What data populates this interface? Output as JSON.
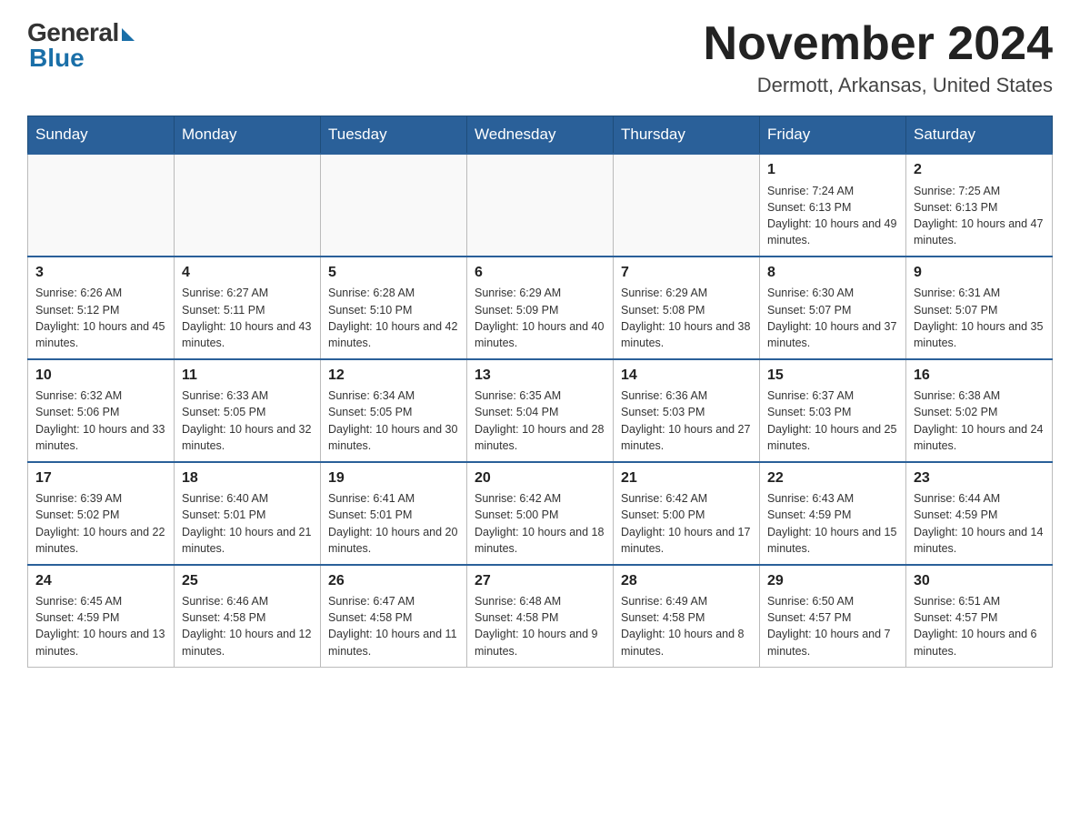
{
  "header": {
    "logo_general": "General",
    "logo_blue": "Blue",
    "month_title": "November 2024",
    "location": "Dermott, Arkansas, United States"
  },
  "weekdays": [
    "Sunday",
    "Monday",
    "Tuesday",
    "Wednesday",
    "Thursday",
    "Friday",
    "Saturday"
  ],
  "weeks": [
    [
      {
        "day": "",
        "info": ""
      },
      {
        "day": "",
        "info": ""
      },
      {
        "day": "",
        "info": ""
      },
      {
        "day": "",
        "info": ""
      },
      {
        "day": "",
        "info": ""
      },
      {
        "day": "1",
        "info": "Sunrise: 7:24 AM\nSunset: 6:13 PM\nDaylight: 10 hours and 49 minutes."
      },
      {
        "day": "2",
        "info": "Sunrise: 7:25 AM\nSunset: 6:13 PM\nDaylight: 10 hours and 47 minutes."
      }
    ],
    [
      {
        "day": "3",
        "info": "Sunrise: 6:26 AM\nSunset: 5:12 PM\nDaylight: 10 hours and 45 minutes."
      },
      {
        "day": "4",
        "info": "Sunrise: 6:27 AM\nSunset: 5:11 PM\nDaylight: 10 hours and 43 minutes."
      },
      {
        "day": "5",
        "info": "Sunrise: 6:28 AM\nSunset: 5:10 PM\nDaylight: 10 hours and 42 minutes."
      },
      {
        "day": "6",
        "info": "Sunrise: 6:29 AM\nSunset: 5:09 PM\nDaylight: 10 hours and 40 minutes."
      },
      {
        "day": "7",
        "info": "Sunrise: 6:29 AM\nSunset: 5:08 PM\nDaylight: 10 hours and 38 minutes."
      },
      {
        "day": "8",
        "info": "Sunrise: 6:30 AM\nSunset: 5:07 PM\nDaylight: 10 hours and 37 minutes."
      },
      {
        "day": "9",
        "info": "Sunrise: 6:31 AM\nSunset: 5:07 PM\nDaylight: 10 hours and 35 minutes."
      }
    ],
    [
      {
        "day": "10",
        "info": "Sunrise: 6:32 AM\nSunset: 5:06 PM\nDaylight: 10 hours and 33 minutes."
      },
      {
        "day": "11",
        "info": "Sunrise: 6:33 AM\nSunset: 5:05 PM\nDaylight: 10 hours and 32 minutes."
      },
      {
        "day": "12",
        "info": "Sunrise: 6:34 AM\nSunset: 5:05 PM\nDaylight: 10 hours and 30 minutes."
      },
      {
        "day": "13",
        "info": "Sunrise: 6:35 AM\nSunset: 5:04 PM\nDaylight: 10 hours and 28 minutes."
      },
      {
        "day": "14",
        "info": "Sunrise: 6:36 AM\nSunset: 5:03 PM\nDaylight: 10 hours and 27 minutes."
      },
      {
        "day": "15",
        "info": "Sunrise: 6:37 AM\nSunset: 5:03 PM\nDaylight: 10 hours and 25 minutes."
      },
      {
        "day": "16",
        "info": "Sunrise: 6:38 AM\nSunset: 5:02 PM\nDaylight: 10 hours and 24 minutes."
      }
    ],
    [
      {
        "day": "17",
        "info": "Sunrise: 6:39 AM\nSunset: 5:02 PM\nDaylight: 10 hours and 22 minutes."
      },
      {
        "day": "18",
        "info": "Sunrise: 6:40 AM\nSunset: 5:01 PM\nDaylight: 10 hours and 21 minutes."
      },
      {
        "day": "19",
        "info": "Sunrise: 6:41 AM\nSunset: 5:01 PM\nDaylight: 10 hours and 20 minutes."
      },
      {
        "day": "20",
        "info": "Sunrise: 6:42 AM\nSunset: 5:00 PM\nDaylight: 10 hours and 18 minutes."
      },
      {
        "day": "21",
        "info": "Sunrise: 6:42 AM\nSunset: 5:00 PM\nDaylight: 10 hours and 17 minutes."
      },
      {
        "day": "22",
        "info": "Sunrise: 6:43 AM\nSunset: 4:59 PM\nDaylight: 10 hours and 15 minutes."
      },
      {
        "day": "23",
        "info": "Sunrise: 6:44 AM\nSunset: 4:59 PM\nDaylight: 10 hours and 14 minutes."
      }
    ],
    [
      {
        "day": "24",
        "info": "Sunrise: 6:45 AM\nSunset: 4:59 PM\nDaylight: 10 hours and 13 minutes."
      },
      {
        "day": "25",
        "info": "Sunrise: 6:46 AM\nSunset: 4:58 PM\nDaylight: 10 hours and 12 minutes."
      },
      {
        "day": "26",
        "info": "Sunrise: 6:47 AM\nSunset: 4:58 PM\nDaylight: 10 hours and 11 minutes."
      },
      {
        "day": "27",
        "info": "Sunrise: 6:48 AM\nSunset: 4:58 PM\nDaylight: 10 hours and 9 minutes."
      },
      {
        "day": "28",
        "info": "Sunrise: 6:49 AM\nSunset: 4:58 PM\nDaylight: 10 hours and 8 minutes."
      },
      {
        "day": "29",
        "info": "Sunrise: 6:50 AM\nSunset: 4:57 PM\nDaylight: 10 hours and 7 minutes."
      },
      {
        "day": "30",
        "info": "Sunrise: 6:51 AM\nSunset: 4:57 PM\nDaylight: 10 hours and 6 minutes."
      }
    ]
  ]
}
